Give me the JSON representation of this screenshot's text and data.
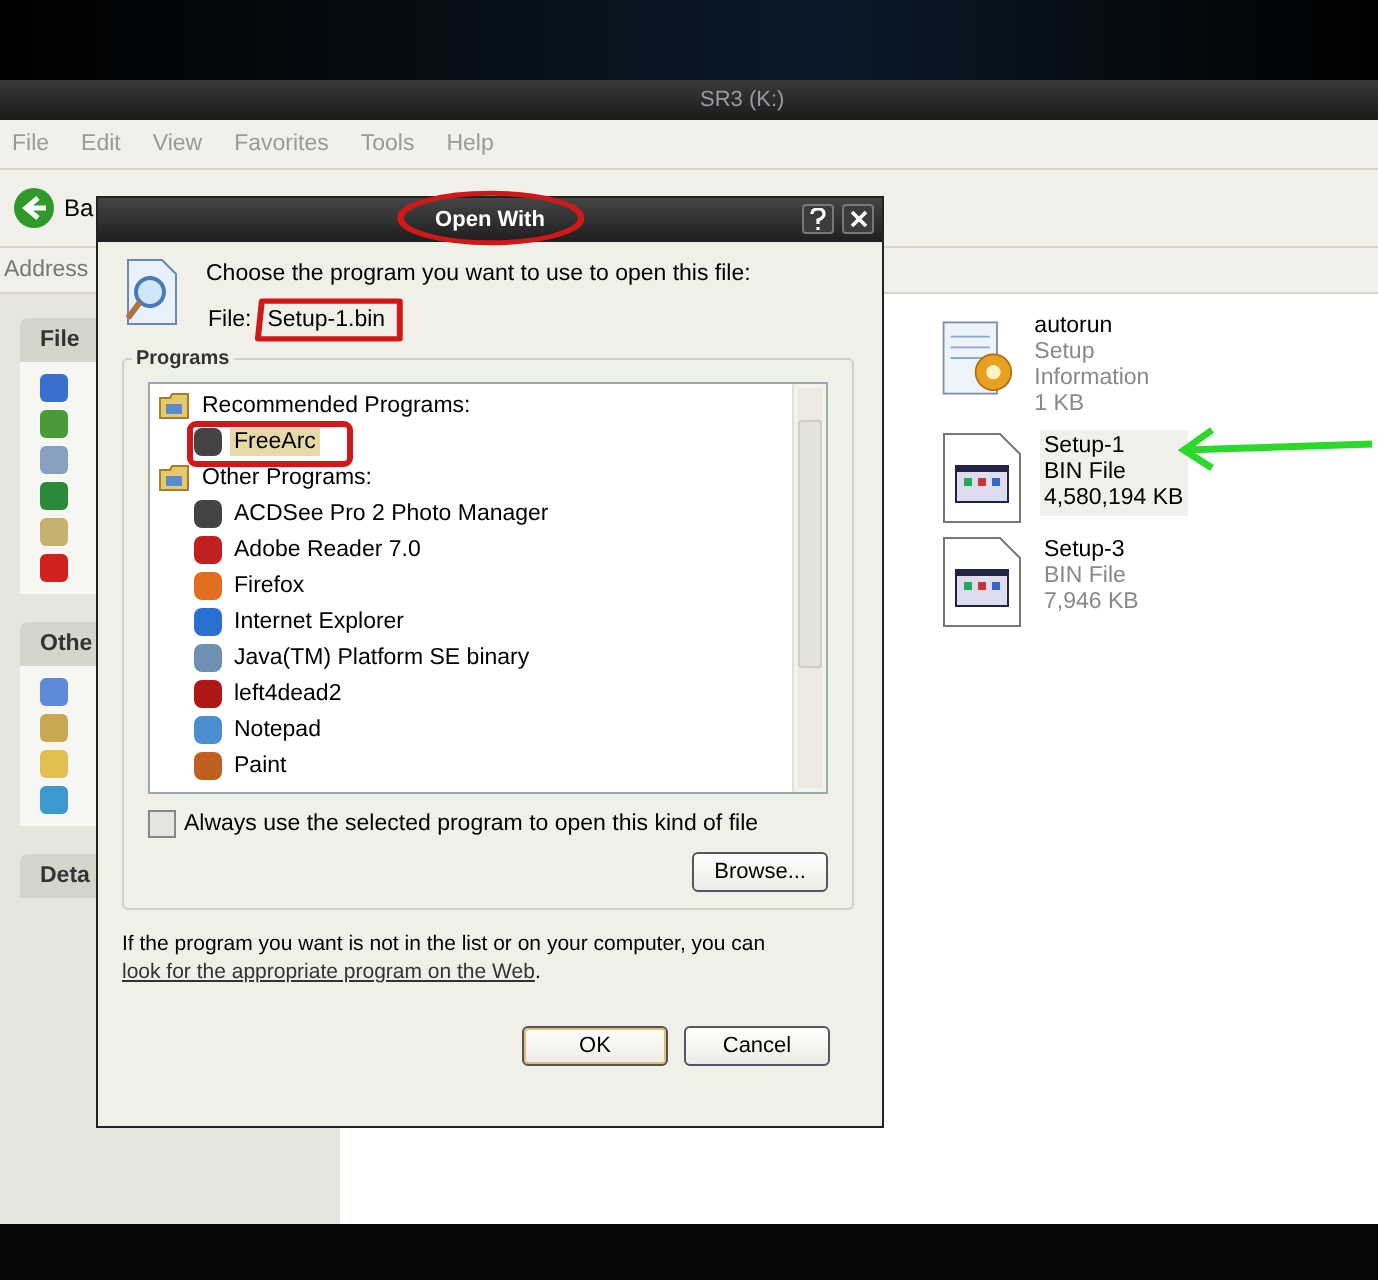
{
  "explorer": {
    "title": "SR3 (K:)",
    "menu": [
      "File",
      "Edit",
      "View",
      "Favorites",
      "Tools",
      "Help"
    ],
    "back_button": "Ba",
    "address_label": "Address",
    "panels": [
      {
        "title": "File"
      },
      {
        "title": "Othe"
      },
      {
        "title": "Deta"
      }
    ],
    "files": [
      {
        "name": "autorun",
        "type": "Setup Information",
        "size": "1 KB",
        "kind": "setup",
        "selected": false
      },
      {
        "name": "Setup-1",
        "type": "BIN File",
        "size": "4,580,194 KB",
        "kind": "bin",
        "selected": true
      },
      {
        "name": "Setup-3",
        "type": "BIN File",
        "size": "7,946 KB",
        "kind": "bin",
        "selected": false
      }
    ]
  },
  "dialog": {
    "title": "Open With",
    "prompt": "Choose the program you want to use to open this file:",
    "file_label": "File:",
    "file_name": "Setup-1.bin",
    "group_label": "Programs",
    "programs": [
      {
        "label": "Recommended Programs:",
        "children": [
          {
            "label": "FreeArc",
            "selected": true
          }
        ]
      },
      {
        "label": "Other Programs:",
        "children": [
          {
            "label": "ACDSee Pro 2 Photo Manager",
            "selected": false
          },
          {
            "label": "Adobe Reader 7.0",
            "selected": false
          },
          {
            "label": "Firefox",
            "selected": false
          },
          {
            "label": "Internet Explorer",
            "selected": false
          },
          {
            "label": "Java(TM) Platform SE binary",
            "selected": false
          },
          {
            "label": "left4dead2",
            "selected": false
          },
          {
            "label": "Notepad",
            "selected": false
          },
          {
            "label": "Paint",
            "selected": false
          }
        ]
      }
    ],
    "always_use": {
      "label": "Always use the selected program to open this kind of file",
      "checked": false
    },
    "browse_button": "Browse...",
    "note": "If the program you want is not in the list or on your computer, you can",
    "note_link": "look for the appropriate program on the Web",
    "note_end": ".",
    "buttons": [
      "OK",
      "Cancel"
    ]
  }
}
